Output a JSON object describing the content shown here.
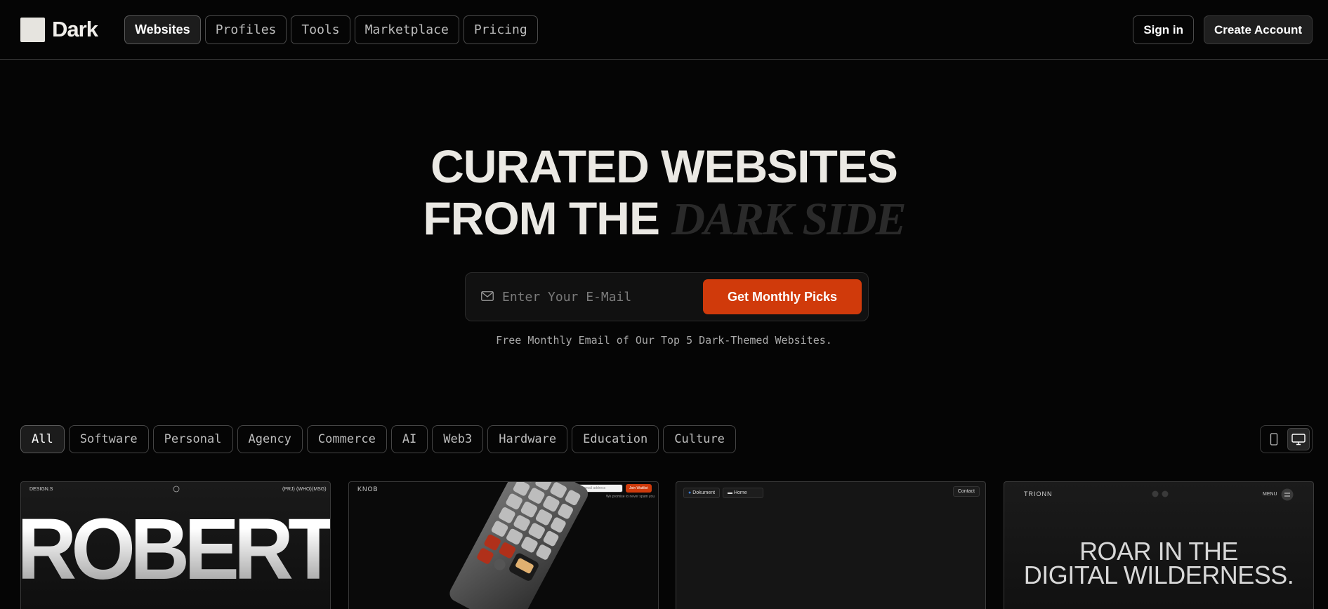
{
  "brand": {
    "name": "Dark"
  },
  "nav": {
    "items": [
      {
        "label": "Websites",
        "active": true
      },
      {
        "label": "Profiles",
        "active": false
      },
      {
        "label": "Tools",
        "active": false
      },
      {
        "label": "Marketplace",
        "active": false
      },
      {
        "label": "Pricing",
        "active": false
      }
    ]
  },
  "auth": {
    "sign_in": "Sign in",
    "create_account": "Create Account"
  },
  "hero": {
    "line1": "CURATED WEBSITES",
    "line2_prefix": "FROM THE",
    "line2_emphasis": "DARK SIDE"
  },
  "signup": {
    "placeholder": "Enter Your E-Mail",
    "button": "Get Monthly Picks",
    "subtext": "Free Monthly Email of Our Top 5 Dark-Themed Websites."
  },
  "filters": [
    "All",
    "Software",
    "Personal",
    "Agency",
    "Commerce",
    "AI",
    "Web3",
    "Hardware",
    "Education",
    "Culture"
  ],
  "active_filter": "All",
  "colors": {
    "accent": "#d03a0b",
    "background": "#050505",
    "text": "#ebe9e4"
  },
  "cards": {
    "c1": {
      "brand": "DESIGN.S",
      "links": [
        "(PRJ)",
        "(WHO)",
        "(MSG)"
      ],
      "headline": "ROBERT BORG"
    },
    "c2": {
      "brand": "KNOB",
      "input_placeholder": "your email address",
      "button": "Join Waitlist",
      "note": "We promise to never spam you"
    },
    "c3": {
      "tab1": "Dokument",
      "tab2": "Home",
      "button": "Contact"
    },
    "c4": {
      "brand": "TRIONN",
      "menu": "MENU",
      "headline_line1": "ROAR IN THE",
      "headline_line2": "DIGITAL WILDERNESS."
    }
  }
}
